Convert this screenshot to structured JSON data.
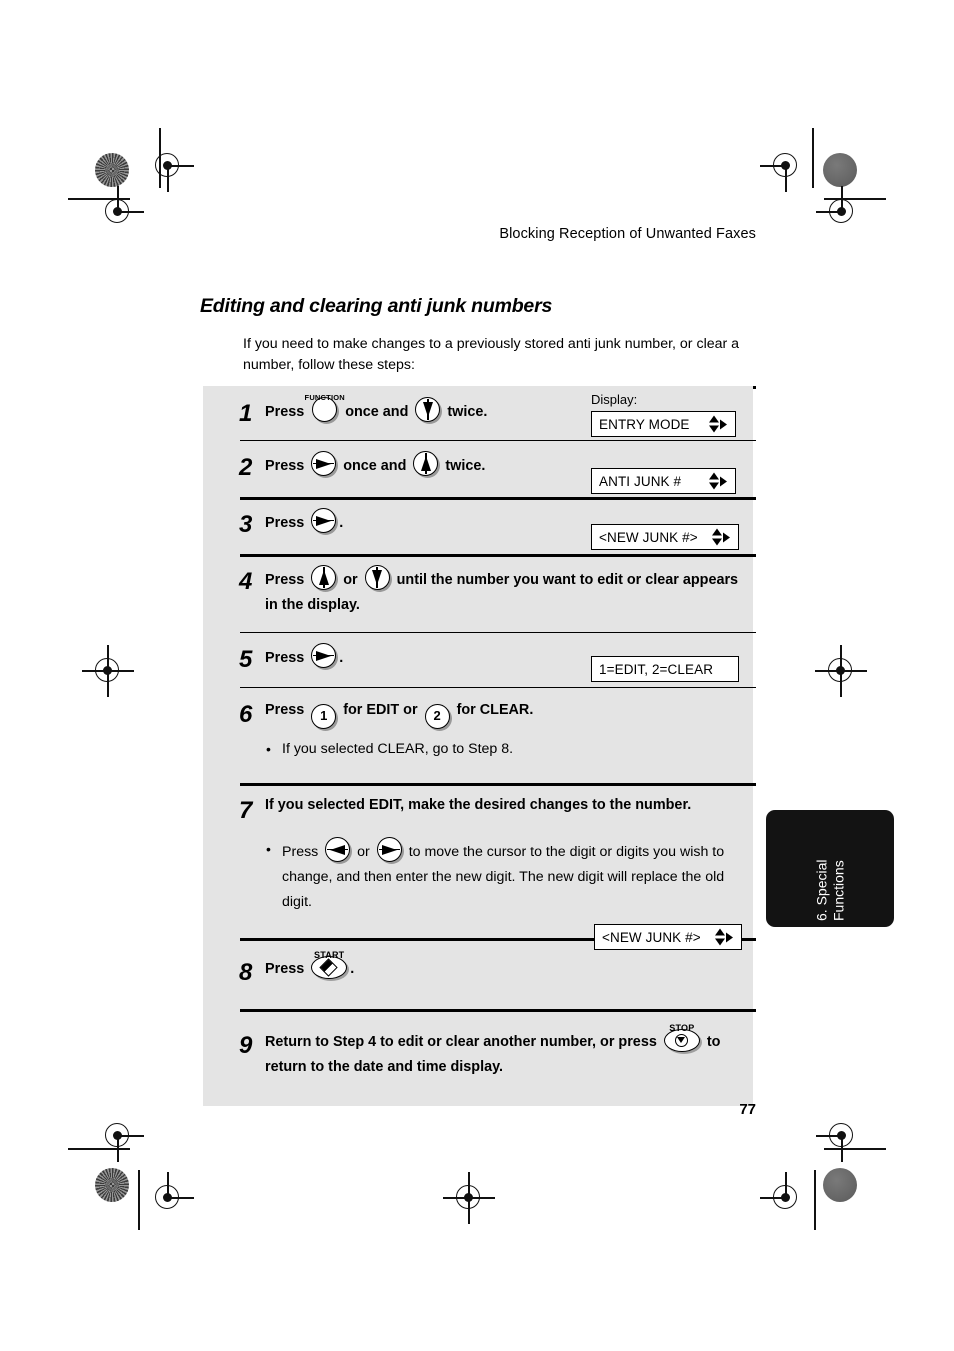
{
  "running_head": "Blocking Reception of Unwanted Faxes",
  "section_title": "Editing and clearing anti junk numbers",
  "intro": "If you need to make changes to a previously stored anti junk number, or clear a number, follow these steps:",
  "display_label": "Display:",
  "page_number": "77",
  "side_tab": "6. Special\nFunctions",
  "keys": {
    "function_label": "FUNCTION",
    "start_label": "START",
    "stop_label": "STOP",
    "digit_one": "1",
    "digit_two": "2"
  },
  "steps": [
    {
      "num": "1",
      "pre": "Press",
      "mid": "once and",
      "post": "twice.",
      "display": "ENTRY MODE"
    },
    {
      "num": "2",
      "pre": "Press",
      "mid": "once and",
      "post": "twice.",
      "display": "ANTI JUNK #"
    },
    {
      "num": "3",
      "pre": "Press",
      "post": ".",
      "display": "<NEW JUNK #>"
    },
    {
      "num": "4",
      "pre": "Press",
      "mid": "or",
      "post": "until the number you want to edit or clear appears in the display."
    },
    {
      "num": "5",
      "pre": "Press",
      "post": ".",
      "display": "1=EDIT, 2=CLEAR"
    },
    {
      "num": "6",
      "pre": "Press",
      "mid": "for EDIT or",
      "post": "for CLEAR.",
      "bullet": "If you selected CLEAR, go to Step 8."
    },
    {
      "num": "7",
      "heading": "If you selected EDIT, make the desired changes to the number.",
      "bullet_pre": "Press",
      "bullet_mid": "or",
      "bullet_post": "to move the cursor to the digit or digits you wish to change, and then enter the new digit. The new digit will replace the old digit."
    },
    {
      "num": "8",
      "pre": "Press",
      "post": ".",
      "display": "<NEW JUNK #>"
    },
    {
      "num": "9",
      "pre": "Return to Step 4 to edit or clear another number, or press",
      "post": "to return to the date and time display."
    }
  ]
}
